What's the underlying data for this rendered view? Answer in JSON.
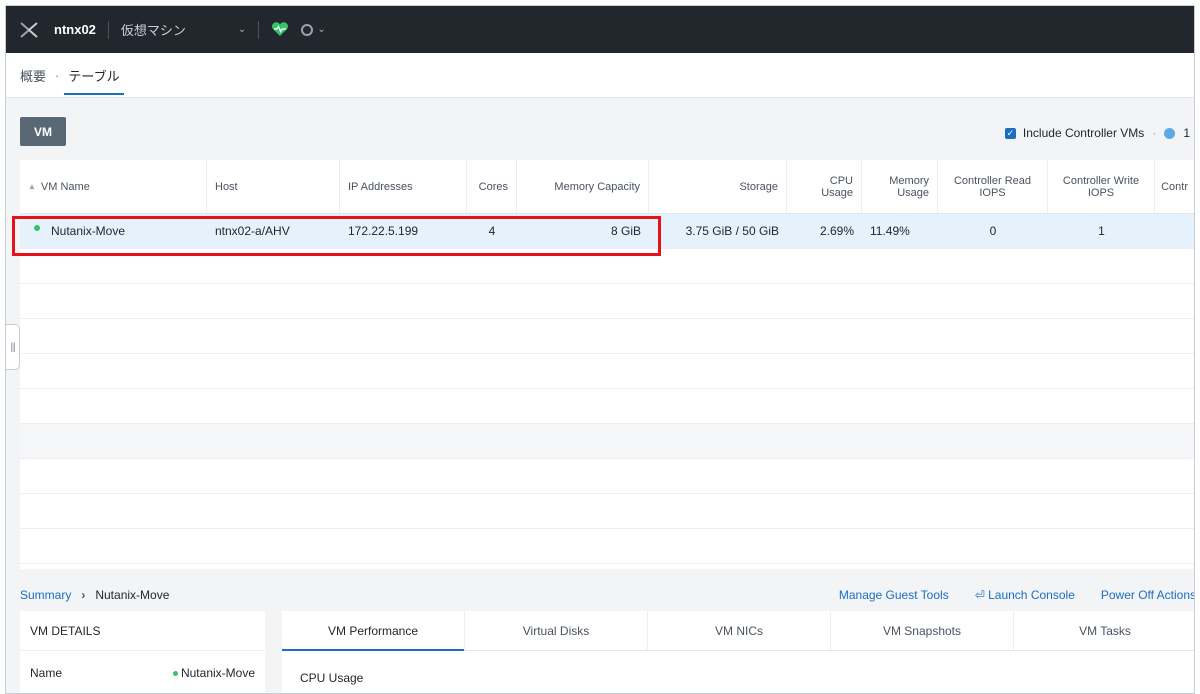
{
  "topbar": {
    "cluster": "ntnx02",
    "page": "仮想マシン",
    "dropdown_caret": "⌄",
    "status_caret": "⌄"
  },
  "subnav": {
    "tabs": [
      {
        "label": "概要",
        "active": false
      },
      {
        "label": "テーブル",
        "active": true
      }
    ]
  },
  "toolbar": {
    "vm_button": "VM",
    "include_controller": "Include Controller VMs",
    "count": "1"
  },
  "table": {
    "columns": [
      "VM Name",
      "Host",
      "IP Addresses",
      "Cores",
      "Memory Capacity",
      "Storage",
      "CPU Usage",
      "Memory Usage",
      "Controller Read IOPS",
      "Controller Write IOPS",
      "Contr"
    ],
    "rows": [
      {
        "status": "on",
        "vm_name": "Nutanix-Move",
        "host": "ntnx02-a/AHV",
        "ip": "172.22.5.199",
        "cores": "4",
        "memory": "8 GiB",
        "storage": "3.75 GiB / 50 GiB",
        "cpu": "2.69%",
        "mem_usage": "11.49%",
        "read_iops": "0",
        "write_iops": "1",
        "contr": ""
      }
    ]
  },
  "summary": {
    "crumb": "Summary",
    "vm_name": "Nutanix-Move",
    "actions": [
      "Manage Guest Tools",
      "Launch Console",
      "Power Off Actions"
    ],
    "launch_icon": "⏎"
  },
  "details": {
    "title": "VM DETAILS",
    "name_label": "Name",
    "name_value": "Nutanix-Move"
  },
  "perf": {
    "tabs": [
      "VM Performance",
      "Virtual Disks",
      "VM NICs",
      "VM Snapshots",
      "VM Tasks"
    ],
    "active_tab": "VM Performance",
    "cpu_label": "CPU Usage"
  },
  "colors": {
    "accent": "#1b6ec2",
    "highlight": "#e8111b",
    "status_on": "#36c26b",
    "topbar": "#22272e"
  }
}
